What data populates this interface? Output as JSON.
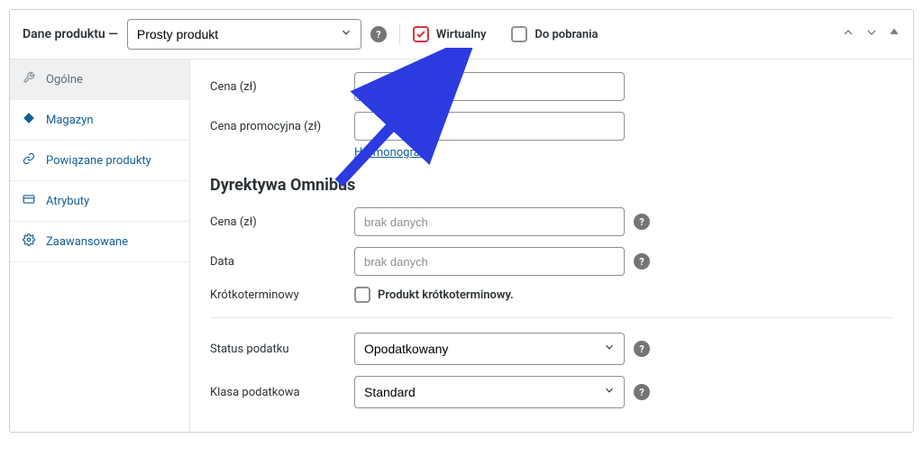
{
  "header": {
    "title": "Dane produktu —",
    "product_type": "Prosty produkt",
    "virtual_label": "Wirtualny",
    "downloadable_label": "Do pobrania"
  },
  "sidebar": {
    "items": [
      {
        "label": "Ogólne",
        "icon": "wrench"
      },
      {
        "label": "Magazyn",
        "icon": "diamond"
      },
      {
        "label": "Powiązane produkty",
        "icon": "link"
      },
      {
        "label": "Atrybuty",
        "icon": "card"
      },
      {
        "label": "Zaawansowane",
        "icon": "gear"
      }
    ]
  },
  "general": {
    "price_label": "Cena (zł)",
    "sale_price_label": "Cena promocyjna (zł)",
    "schedule_link": "Harmonogram"
  },
  "omnibus": {
    "heading": "Dyrektywa Omnibus",
    "price_label": "Cena (zł)",
    "price_placeholder": "brak danych",
    "date_label": "Data",
    "date_placeholder": "brak danych",
    "shortterm_label": "Krótkoterminowy",
    "shortterm_checkbox": "Produkt krótkoterminowy."
  },
  "tax": {
    "status_label": "Status podatku",
    "status_value": "Opodatkowany",
    "class_label": "Klasa podatkowa",
    "class_value": "Standard"
  }
}
